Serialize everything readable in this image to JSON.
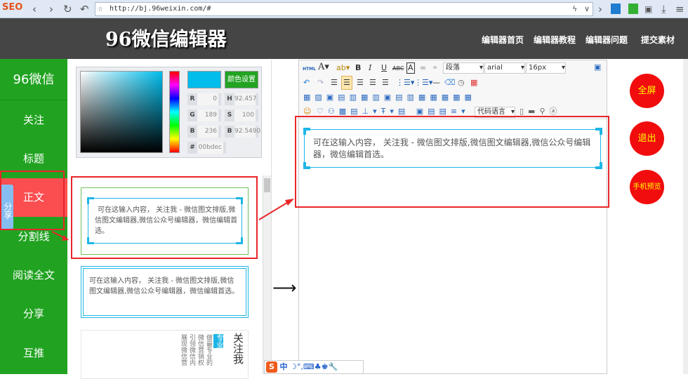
{
  "browser": {
    "seo_badge": "SEO",
    "url": "http://bj.96weixin.com/#"
  },
  "header": {
    "logo": "96微信编辑器",
    "nav": [
      "编辑器首页",
      "编辑器教程",
      "编辑器问题",
      "提交素材"
    ]
  },
  "sidebar": {
    "brand": "96微信",
    "items": [
      "关注",
      "标题",
      "正文",
      "分割线",
      "阅读全文",
      "分享",
      "互推"
    ],
    "active": "正文",
    "float_tab": "分享"
  },
  "color_picker": {
    "set_button": "颜色设置",
    "R": "0",
    "G": "189",
    "B": "236",
    "H": "92.457",
    "S": "100",
    "Bv": "92.5490",
    "hex": "00bdec",
    "current_color": "#00bdec"
  },
  "styles": {
    "item1_text": "可在这输入内容， 关注我 - 微信图文排版,微信图文编辑器,微信公众号编辑器，微信编辑首选。",
    "item2_text": "可在这输入内容， 关注我 - 微信图文排版,微信图文编辑器,微信公众号编辑器，微信编辑首选。",
    "item3": {
      "title": "关注我",
      "tag": "专业",
      "cols": [
        "做最专业的",
        "微信营销权",
        "引领微信内",
        "展现微信营"
      ]
    }
  },
  "arrow": "⟶",
  "editor": {
    "paragraph": "段落",
    "font": "arial",
    "size": "16px",
    "code_lang": "代码语言",
    "content": "可在这输入内容， 关注我 - 微信图文排版,微信图文编辑器,微信公众号编辑器，微信编辑首选。"
  },
  "right_buttons": [
    "全屏",
    "退出",
    "手机预览"
  ],
  "ime": {
    "label": "中"
  }
}
